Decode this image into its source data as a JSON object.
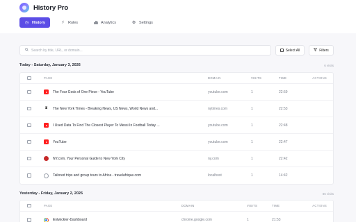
{
  "app": {
    "title": "History Pro"
  },
  "nav": {
    "tabs": [
      {
        "label": "History",
        "icon": "clock-icon",
        "active": true
      },
      {
        "label": "Rules",
        "icon": "bolt-icon",
        "active": false
      },
      {
        "label": "Analytics",
        "icon": "chart-icon",
        "active": false
      },
      {
        "label": "Settings",
        "icon": "gear-icon",
        "active": false
      }
    ]
  },
  "search": {
    "placeholder": "Search by title, URL, or domain...",
    "value": ""
  },
  "toolbar": {
    "select_all_label": "Select All",
    "filters_label": "Filters"
  },
  "columns": {
    "page": "PAGE",
    "domain": "DOMAIN",
    "visits": "VISITS",
    "time": "TIME",
    "actions": "ACTIONS"
  },
  "groups": [
    {
      "title": "Today - Saturday, January 3, 2026",
      "count": "6 visits",
      "rows": [
        {
          "favicon": "youtube-icon",
          "title": "The Four Gods of One Piece - YouTube",
          "domain": "youtube.com",
          "visits": "1",
          "time": "22:59"
        },
        {
          "favicon": "nyt-icon",
          "title": "The New York Times - Breaking News, US News, World News and...",
          "domain": "nytimes.com",
          "visits": "1",
          "time": "22:53"
        },
        {
          "favicon": "youtube-icon",
          "title": "I Used Data To Find The Closest Player To Messi In Football Today ...",
          "domain": "youtube.com",
          "visits": "1",
          "time": "22:48"
        },
        {
          "favicon": "youtube-icon",
          "title": "YouTube",
          "domain": "youtube.com",
          "visits": "1",
          "time": "22:47"
        },
        {
          "favicon": "apple-icon",
          "title": "NY.com, Your Personal Guide to New York City",
          "domain": "ny.com",
          "visits": "1",
          "time": "22:42"
        },
        {
          "favicon": "globe-icon",
          "title": "Tailored trips and group tours to Africa - travelafrique.com",
          "domain": "localhost",
          "visits": "1",
          "time": "14:42"
        }
      ]
    },
    {
      "title": "Yesterday - Friday, January 2, 2026",
      "count": "86 visits",
      "rows": [
        {
          "favicon": "chrome-icon",
          "title": "Entwickler-Dashboard",
          "domain": "chrome.google.com",
          "visits": "1",
          "time": "21:53"
        }
      ]
    }
  ]
}
